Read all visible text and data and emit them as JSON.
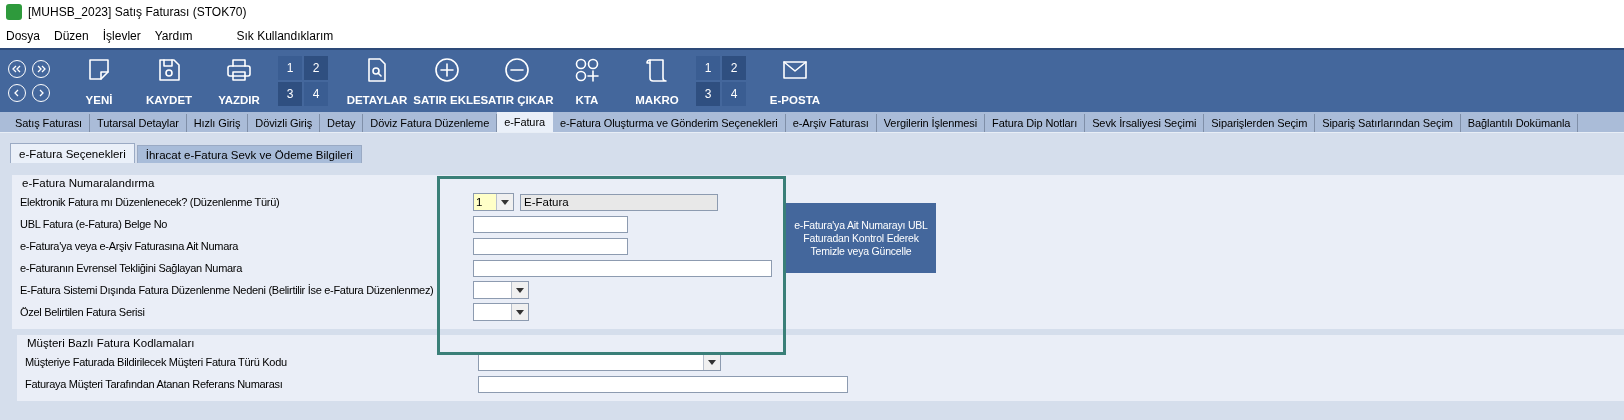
{
  "window": {
    "title": "[MUHSB_2023] Satış Faturası (STOK70)"
  },
  "menu": [
    "Dosya",
    "Düzen",
    "İşlevler",
    "Yardım",
    "Sık Kullandıklarım"
  ],
  "toolbar": [
    {
      "kind": "nav"
    },
    {
      "kind": "button",
      "label": "YENİ"
    },
    {
      "kind": "button",
      "label": "KAYDET"
    },
    {
      "kind": "button",
      "label": "YAZDIR"
    },
    {
      "kind": "grid",
      "cells": [
        "1",
        "2",
        "3",
        "4"
      ]
    },
    {
      "kind": "button",
      "label": "DETAYLAR"
    },
    {
      "kind": "button",
      "label": "SATIR EKLE"
    },
    {
      "kind": "button",
      "label": "SATIR ÇIKAR"
    },
    {
      "kind": "button",
      "label": "KTA"
    },
    {
      "kind": "button",
      "label": "MAKRO"
    },
    {
      "kind": "grid",
      "cells": [
        "1",
        "2",
        "3",
        "4"
      ]
    },
    {
      "kind": "button",
      "label": "E-POSTA"
    }
  ],
  "tabs": [
    {
      "label": "Satış Faturası",
      "selected": false
    },
    {
      "label": "Tutarsal Detaylar",
      "selected": false
    },
    {
      "label": "Hızlı Giriş",
      "selected": false
    },
    {
      "label": "Dövizli Giriş",
      "selected": false
    },
    {
      "label": "Detay",
      "selected": false
    },
    {
      "label": "Döviz Fatura Düzenleme",
      "selected": false
    },
    {
      "label": "e-Fatura",
      "selected": true
    },
    {
      "label": "e-Fatura Oluşturma ve Gönderim Seçenekleri",
      "selected": false
    },
    {
      "label": "e-Arşiv Faturası",
      "selected": false
    },
    {
      "label": "Vergilerin İşlenmesi",
      "selected": false
    },
    {
      "label": "Fatura Dip Notları",
      "selected": false
    },
    {
      "label": "Sevk İrsaliyesi Seçimi",
      "selected": false
    },
    {
      "label": "Siparişlerden Seçim",
      "selected": false
    },
    {
      "label": "Sipariş Satırlarından Seçim",
      "selected": false
    },
    {
      "label": "Bağlantılı Dokümanla",
      "selected": false
    }
  ],
  "subtabs": [
    {
      "label": "e-Fatura Seçenekleri",
      "selected": true
    },
    {
      "label": "İhracat e-Fatura Sevk ve Ödeme Bilgileri",
      "selected": false
    }
  ],
  "numbering_group": {
    "title": "e-Fatura Numaralandırma",
    "rows": [
      {
        "label": "Elektronik Fatura mı Düzenlenecek? (Düzenlenme Türü)",
        "kind": "code-combo",
        "value": "1",
        "description": "E-Fatura"
      },
      {
        "label": "UBL Fatura (e-Fatura) Belge No",
        "kind": "text"
      },
      {
        "label": "e-Fatura'ya veya e-Arşiv Faturasına Ait Numara",
        "kind": "text"
      },
      {
        "label": "e-Faturanın Evrensel Tekliğini Sağlayan Numara",
        "kind": "wide-text"
      },
      {
        "label": "E-Fatura Sistemi Dışında Fatura Düzenlenme Nedeni (Belirtilir İse e-Fatura Düzenlenmez)",
        "kind": "small-combo"
      },
      {
        "label": "Özel Belirtilen Fatura Serisi",
        "kind": "small-combo"
      }
    ],
    "action_button": "e-Fatura'ya Ait Numarayı UBL Faturadan Kontrol Ederek Temizle veya Güncelle"
  },
  "customer_group": {
    "title": "Müşteri Bazlı Fatura Kodlamaları",
    "rows": [
      {
        "label": "Müşteriye Faturada Bildirilecek Müşteri Fatura Türü Kodu",
        "kind": "long-combo"
      },
      {
        "label": "Faturaya Müşteri Tarafından Atanan Referans Numarası",
        "kind": "long-text"
      }
    ]
  }
}
